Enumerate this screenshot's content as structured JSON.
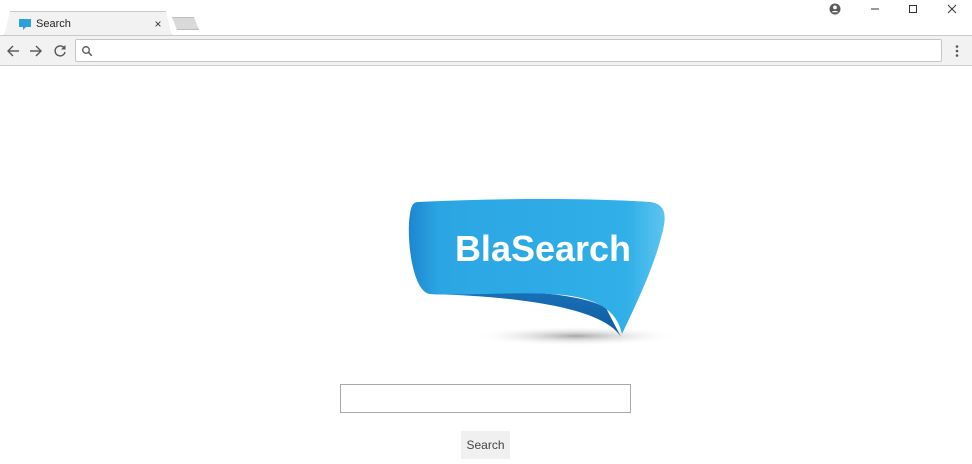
{
  "browser": {
    "tab": {
      "title": "Search",
      "close_glyph": "×",
      "favicon": "speech-bubble-icon"
    },
    "new_tab": "new-tab-button",
    "window_controls": [
      "profile-icon",
      "minimize-icon",
      "maximize-icon",
      "close-icon"
    ],
    "nav": [
      "back-arrow-icon",
      "forward-arrow-icon",
      "reload-icon"
    ],
    "omnibox": {
      "value": "",
      "icon": "search-icon"
    },
    "menu": "more-vert-icon"
  },
  "page": {
    "logo_text": "BlaSearch",
    "search_input_value": "",
    "search_button_label": "Search"
  },
  "colors": {
    "brand_blue": "#2ba6e3",
    "brand_blue_dark": "#1a78c2",
    "favicon_blue": "#2ea1dc"
  }
}
